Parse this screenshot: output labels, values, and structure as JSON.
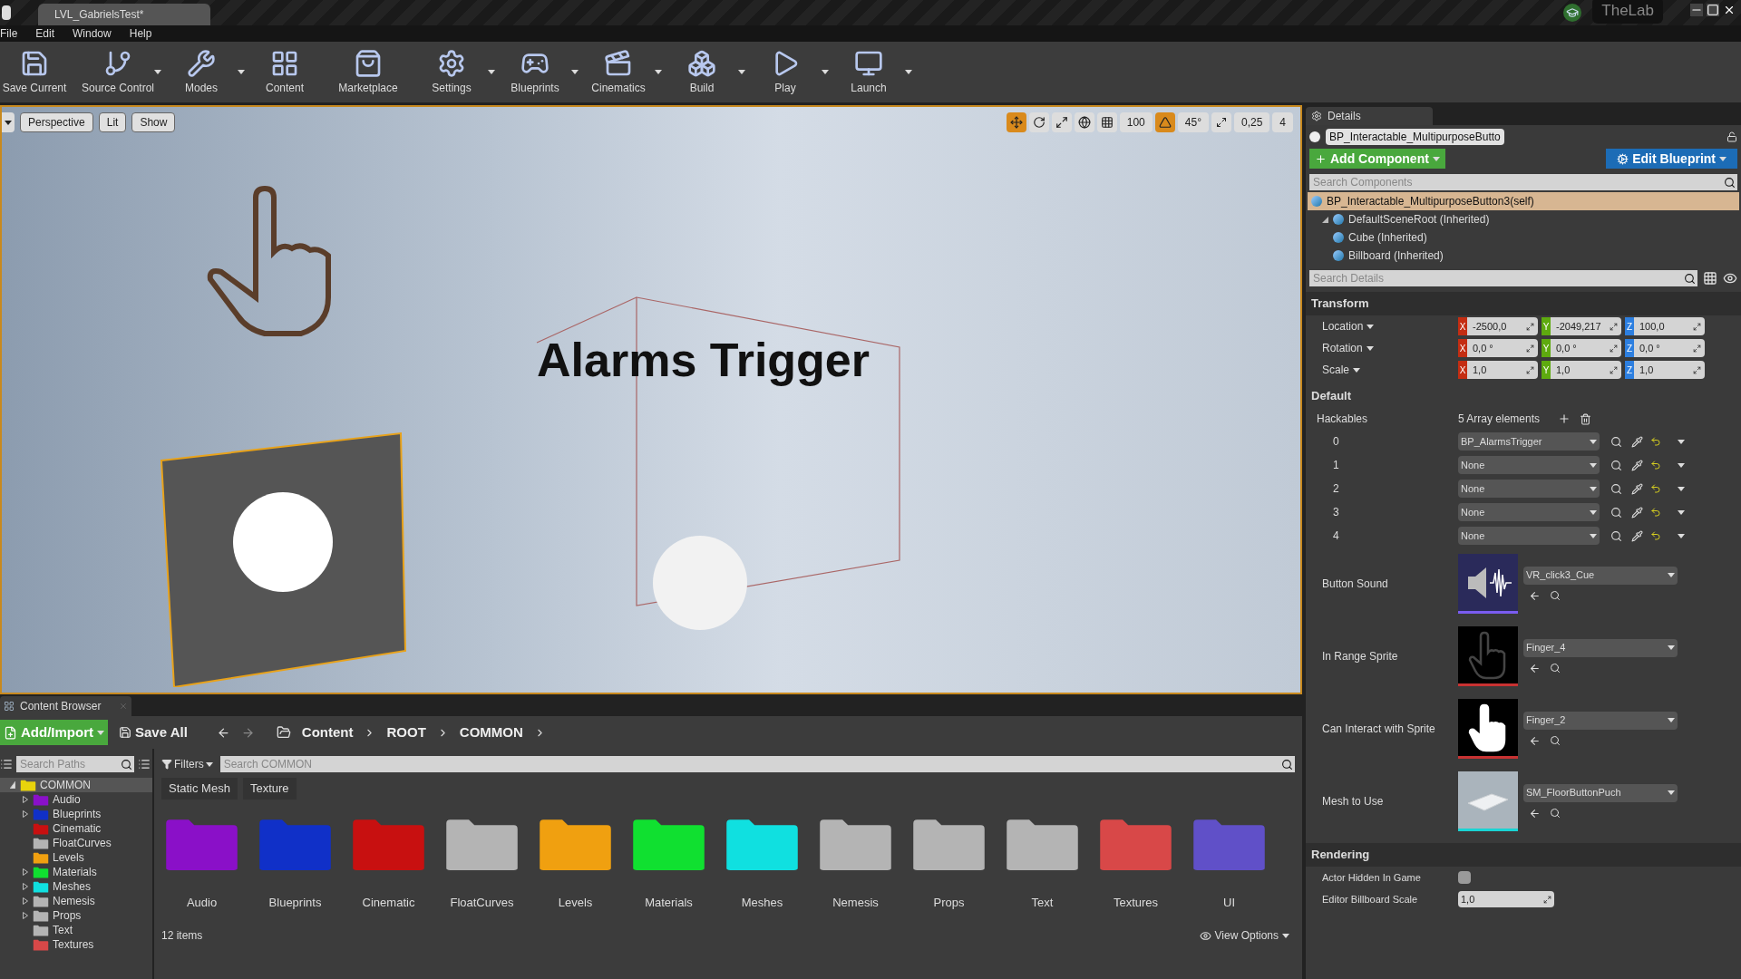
{
  "window": {
    "tab_title": "LVL_GabrielsTest*",
    "user": "TheLab"
  },
  "menu": [
    "File",
    "Edit",
    "Window",
    "Help"
  ],
  "toolbar": [
    {
      "label": "Save Current",
      "kind": "save",
      "dropdown": false
    },
    {
      "label": "Source Control",
      "kind": "source",
      "dropdown": true
    },
    {
      "label": "Modes",
      "kind": "modes",
      "dropdown": true
    },
    {
      "label": "Content",
      "kind": "content",
      "dropdown": false
    },
    {
      "label": "Marketplace",
      "kind": "market",
      "dropdown": false
    },
    {
      "label": "Settings",
      "kind": "settings",
      "dropdown": true
    },
    {
      "label": "Blueprints",
      "kind": "blueprints",
      "dropdown": true
    },
    {
      "label": "Cinematics",
      "kind": "cinematics",
      "dropdown": true
    },
    {
      "label": "Build",
      "kind": "build",
      "dropdown": true
    },
    {
      "label": "Play",
      "kind": "play",
      "dropdown": true
    },
    {
      "label": "Launch",
      "kind": "launch",
      "dropdown": true
    }
  ],
  "viewport": {
    "buttons": [
      "Perspective",
      "Lit",
      "Show"
    ],
    "grid_snap": "100",
    "rotation_snap": "45°",
    "scale_snap": "0,25",
    "camera_speed": "4",
    "scene_text": "Alarms Trigger"
  },
  "details": {
    "tab": "Details",
    "actor_name": "BP_Interactable_MultipurposeButto",
    "add_component": "Add Component",
    "edit_blueprint": "Edit Blueprint",
    "search_components_placeholder": "Search Components",
    "components": [
      {
        "label": "BP_Interactable_MultipurposeButton3(self)",
        "selected": true,
        "children": [
          {
            "label": "DefaultSceneRoot (Inherited)",
            "selected": false,
            "children": [
              {
                "label": "Cube (Inherited)",
                "selected": false
              },
              {
                "label": "Billboard (Inherited)",
                "selected": false
              }
            ]
          }
        ]
      }
    ],
    "search_details_placeholder": "Search Details",
    "transform": {
      "title": "Transform",
      "rows": [
        {
          "label": "Location",
          "axes": [
            {
              "axis": "X",
              "value": "-2500,0"
            },
            {
              "axis": "Y",
              "value": "-2049,217"
            },
            {
              "axis": "Z",
              "value": "100,0"
            }
          ]
        },
        {
          "label": "Rotation",
          "axes": [
            {
              "axis": "X",
              "value": "0,0 °"
            },
            {
              "axis": "Y",
              "value": "0,0 °"
            },
            {
              "axis": "Z",
              "value": "0,0 °"
            }
          ]
        },
        {
          "label": "Scale",
          "axes": [
            {
              "axis": "X",
              "value": "1,0"
            },
            {
              "axis": "Y",
              "value": "1,0"
            },
            {
              "axis": "Z",
              "value": "1,0"
            }
          ]
        }
      ]
    },
    "default": {
      "title": "Default",
      "hackables_label": "Hackables",
      "hackables_count": "5 Array elements",
      "hackables": [
        {
          "index": "0",
          "value": "BP_AlarmsTrigger"
        },
        {
          "index": "1",
          "value": "None"
        },
        {
          "index": "2",
          "value": "None"
        },
        {
          "index": "3",
          "value": "None"
        },
        {
          "index": "4",
          "value": "None"
        }
      ],
      "assets": [
        {
          "label": "Button Sound",
          "value": "VR_click3_Cue",
          "kind": "sound",
          "color": "#7a5cf0"
        },
        {
          "label": "In Range Sprite",
          "value": "Finger_4",
          "kind": "hand-outline",
          "color": "#c83232"
        },
        {
          "label": "Can Interact with Sprite",
          "value": "Finger_2",
          "kind": "hand-solid",
          "color": "#c83232"
        },
        {
          "label": "Mesh to Use",
          "value": "SM_FloorButtonPuch",
          "kind": "mesh",
          "color": "#19d4d4"
        }
      ]
    },
    "rendering": {
      "title": "Rendering",
      "hidden_label": "Actor Hidden In Game",
      "hidden_checked": false,
      "billboard_label": "Editor Billboard Scale",
      "billboard_value": "1,0"
    }
  },
  "content_browser": {
    "tab": "Content Browser",
    "add_import": "Add/Import",
    "save_all": "Save All",
    "path": [
      "Content",
      "ROOT",
      "COMMON"
    ],
    "search_paths_placeholder": "Search Paths",
    "filters": "Filters",
    "search_placeholder": "Search COMMON",
    "filter_chips": [
      "Static Mesh",
      "Texture"
    ],
    "tree": [
      {
        "label": "COMMON",
        "color": "#e8d40c",
        "selected": true,
        "has_children": true,
        "children": [
          {
            "label": "Audio",
            "color": "#8a10c8",
            "selected": false,
            "has_children": true
          },
          {
            "label": "Blueprints",
            "color": "#1030c8",
            "selected": false,
            "has_children": true
          },
          {
            "label": "Cinematic",
            "color": "#c81010",
            "selected": false,
            "has_children": false
          },
          {
            "label": "FloatCurves",
            "color": "#b4b4b4",
            "selected": false,
            "has_children": false
          },
          {
            "label": "Levels",
            "color": "#f0a010",
            "selected": false,
            "has_children": false
          },
          {
            "label": "Materials",
            "color": "#10e030",
            "selected": false,
            "has_children": true
          },
          {
            "label": "Meshes",
            "color": "#10e0e0",
            "selected": false,
            "has_children": true
          },
          {
            "label": "Nemesis",
            "color": "#b4b4b4",
            "selected": false,
            "has_children": true
          },
          {
            "label": "Props",
            "color": "#b4b4b4",
            "selected": false,
            "has_children": true
          },
          {
            "label": "Text",
            "color": "#b4b4b4",
            "selected": false,
            "has_children": false
          },
          {
            "label": "Textures",
            "color": "#d84848",
            "selected": false,
            "has_children": false
          }
        ]
      }
    ],
    "folders": [
      {
        "label": "Audio",
        "color": "#8a10c8"
      },
      {
        "label": "Blueprints",
        "color": "#1030c8"
      },
      {
        "label": "Cinematic",
        "color": "#c81010"
      },
      {
        "label": "FloatCurves",
        "color": "#b4b4b4"
      },
      {
        "label": "Levels",
        "color": "#f0a010"
      },
      {
        "label": "Materials",
        "color": "#10e030"
      },
      {
        "label": "Meshes",
        "color": "#10e0e0"
      },
      {
        "label": "Nemesis",
        "color": "#b4b4b4"
      },
      {
        "label": "Props",
        "color": "#b4b4b4"
      },
      {
        "label": "Text",
        "color": "#b4b4b4"
      },
      {
        "label": "Textures",
        "color": "#d84848"
      },
      {
        "label": "UI",
        "color": "#6050c8"
      }
    ],
    "item_count": "12 items",
    "view_options": "View Options"
  }
}
